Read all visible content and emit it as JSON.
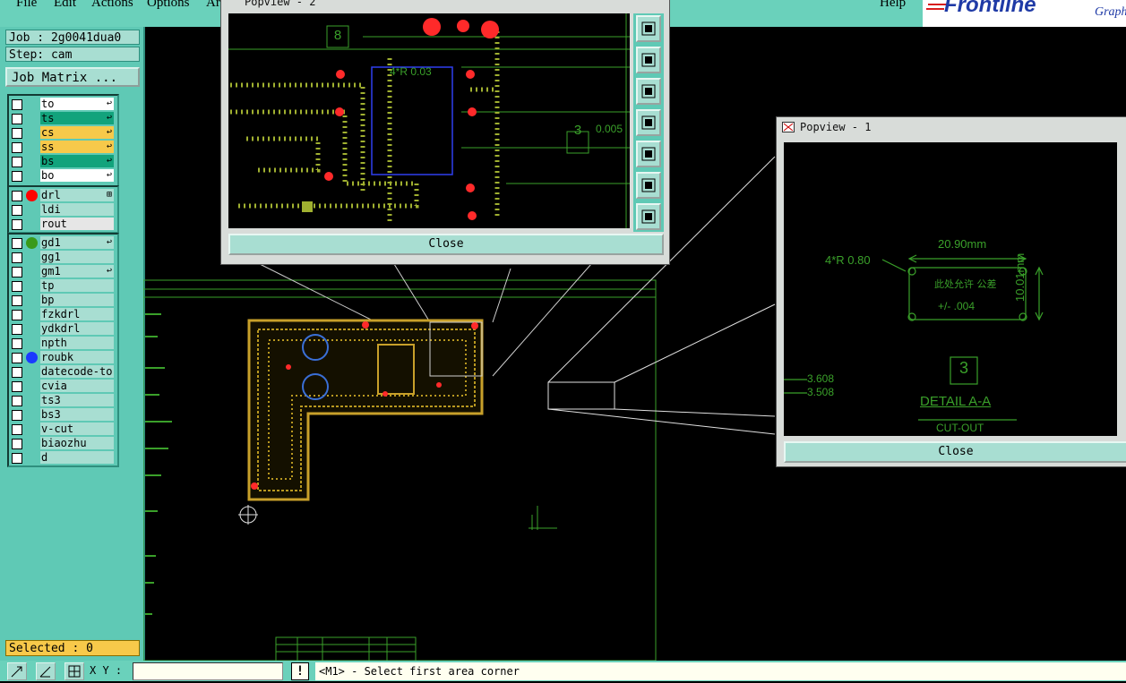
{
  "menubar": {
    "items": [
      "File",
      "Edit",
      "Actions",
      "Options",
      "Ar"
    ],
    "help": "Help",
    "brand": "Frontline",
    "brand_tail": "Graph"
  },
  "job_panel": {
    "job": "Job : 2g0041dua0",
    "step": "Step: cam",
    "job_matrix": "Job Matrix ..."
  },
  "layers": {
    "group1": [
      {
        "name": "to",
        "bg": "#ffffff",
        "mark": "↩"
      },
      {
        "name": "ts",
        "bg": "#12a37c",
        "mark": "↩"
      },
      {
        "name": "cs",
        "bg": "#f7c94a",
        "mark": "↩"
      },
      {
        "name": "ss",
        "bg": "#f7c94a",
        "mark": "↩"
      },
      {
        "name": "bs",
        "bg": "#12a37c",
        "mark": "↩"
      },
      {
        "name": "bo",
        "bg": "#ffffff",
        "mark": "↩"
      }
    ],
    "group2": [
      {
        "name": "drl",
        "bg": "#a8ded2",
        "dot": "#ff0000",
        "mark": "⊞"
      },
      {
        "name": "ldi",
        "bg": "#a8ded2"
      },
      {
        "name": "rout",
        "bg": "#e6e6e6"
      }
    ],
    "group3": [
      {
        "name": "gd1",
        "bg": "#a8ded2",
        "dot": "#3a9a1a",
        "mark": "↩"
      },
      {
        "name": "gg1",
        "bg": "#a8ded2"
      },
      {
        "name": "gm1",
        "bg": "#a8ded2",
        "mark": "↩"
      },
      {
        "name": "tp",
        "bg": "#a8ded2"
      },
      {
        "name": "bp",
        "bg": "#a8ded2"
      },
      {
        "name": "fzkdrl",
        "bg": "#a8ded2"
      },
      {
        "name": "ydkdrl",
        "bg": "#a8ded2"
      },
      {
        "name": "npth",
        "bg": "#a8ded2"
      },
      {
        "name": "roubk",
        "bg": "#a8ded2",
        "dot": "#1a3aff"
      },
      {
        "name": "datecode-to",
        "bg": "#a8ded2"
      },
      {
        "name": "cvia",
        "bg": "#a8ded2"
      },
      {
        "name": "ts3",
        "bg": "#a8ded2"
      },
      {
        "name": "bs3",
        "bg": "#a8ded2"
      },
      {
        "name": "v-cut",
        "bg": "#a8ded2"
      },
      {
        "name": "biaozhu",
        "bg": "#a8ded2"
      },
      {
        "name": "d",
        "bg": "#a8ded2"
      }
    ]
  },
  "selected": "Selected : 0",
  "bottom": {
    "xy_label": "X Y :",
    "xy_value": "",
    "excl": "!",
    "status": "<M1> - Select first area corner"
  },
  "popview2": {
    "title": "Popview - 2",
    "close": "Close",
    "label_8": "8",
    "label_3": "3",
    "radius": "4*R 0.03",
    "value": "0.005"
  },
  "popview1": {
    "title": "Popview - 1",
    "close": "Close",
    "radius": "4*R 0.80",
    "width": "20.90mm",
    "height": "10.01mm",
    "chinese_note": "此处允许 公差",
    "tolerance": "+/- .004",
    "label_3": "3",
    "detail": "DETAIL A-A",
    "cutout": "CUT-OUT",
    "v1": "3.608",
    "v2": "3.508"
  },
  "colors": {
    "panel": "#5fc9b5",
    "canvas": "#000000",
    "board": "#c8a02a",
    "outline": "#3aa02a",
    "drill": "#ff2a2a"
  }
}
